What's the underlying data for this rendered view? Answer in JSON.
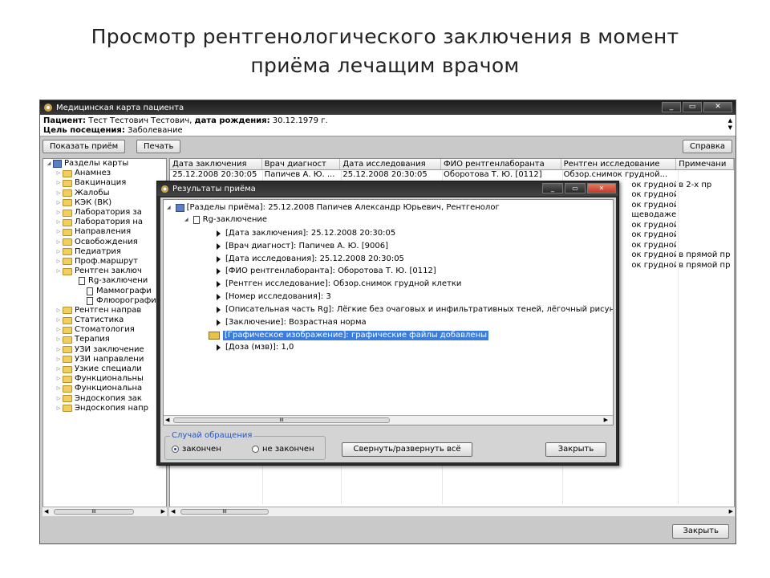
{
  "slide": {
    "title_line1": "Просмотр рентгенологического заключения в момент",
    "title_line2": "приёма лечащим врачом"
  },
  "window": {
    "title": "Медицинская карта пациента",
    "btn_restore": "▭",
    "btn_close": "✕"
  },
  "patient": {
    "label_patient": "Пациент:",
    "name": "Тест Тестович Тестович,",
    "label_birth": "дата рождения:",
    "birth": "30.12.1979 г.",
    "label_goal": "Цель посещения:",
    "goal": "Заболевание"
  },
  "toolbar": {
    "show": "Показать приём",
    "print": "Печать",
    "help": "Справка"
  },
  "tree": {
    "root": "Разделы карты",
    "items": [
      "Анамнез",
      "Вакцинация",
      "Жалобы",
      "КЭК (ВК)",
      "Лаборатория за",
      "Лаборатория на",
      "Направления",
      "Освобождения",
      "Педиатрия",
      "Проф.маршрут",
      "Рентген заключ"
    ],
    "sub_selected": "Rg-заключени",
    "sub_items": [
      "Маммографи",
      "Флюорографи"
    ],
    "items2": [
      "Рентген направ",
      "Статистика",
      "Стоматология",
      "Терапия",
      "УЗИ заключение",
      "УЗИ направлени",
      "Узкие специали",
      "Функциональны",
      "Функциональна",
      "Эндоскопия зак",
      "Эндоскопия напр"
    ],
    "scroll_label": "III"
  },
  "grid": {
    "headers": [
      "Дата заключения",
      "Врач диагност",
      "Дата исследования",
      "ФИО рентгенлаборанта",
      "Рентген исследование",
      "Примечани"
    ],
    "row1": [
      "25.12.2008 20:30:05",
      "Папичев А. Ю. ...",
      "25.12.2008 20:30:05",
      "Оборотова Т. Ю.  [0112]",
      "Обзор.снимок грудной...",
      ""
    ],
    "col5_more": [
      "ок грудной...",
      "ок грудной...",
      "ок грудной...",
      "щеводаже...",
      "ок грудной...",
      "ок грудной...",
      "ок грудной...",
      "ок грудной...",
      "ок грудной..."
    ],
    "col6_notes": [
      "в 2-х пр",
      "в прямой пр",
      "в прямой пр"
    ],
    "scroll_label": "III"
  },
  "footer": {
    "close": "Закрыть"
  },
  "dialog": {
    "title": "Результаты приёма",
    "root": "[Разделы приёма]: 25.12.2008 Папичев Александр Юрьевич, Рентгенолог",
    "node": "Rg-заключение",
    "fields": [
      "[Дата заключения]: 25.12.2008 20:30:05",
      "[Врач диагност]: Папичев А. Ю.  [9006]",
      "[Дата исследования]: 25.12.2008 20:30:05",
      "[ФИО рентгенлаборанта]: Оборотова Т. Ю.  [0112]",
      "[Рентген исследование]: Обзор.снимок грудной клетки",
      "[Номер исследования]: 3",
      "[Описательная часть Rg]: Лёгкие без очаговых и инфильтративных теней, лёгочный рисунок не изме",
      "[Заключение]: Возрастная норма"
    ],
    "selected": "[Графическое изображение]: графические файлы добавлены",
    "last": "[Доза (мзв)]: 1,0",
    "scroll_label": "III",
    "group_label": "Случай обращения",
    "radio_done": "закончен",
    "radio_notdone": "не закончен",
    "toggle_btn": "Свернуть/развернуть всё",
    "close_btn": "Закрыть"
  }
}
